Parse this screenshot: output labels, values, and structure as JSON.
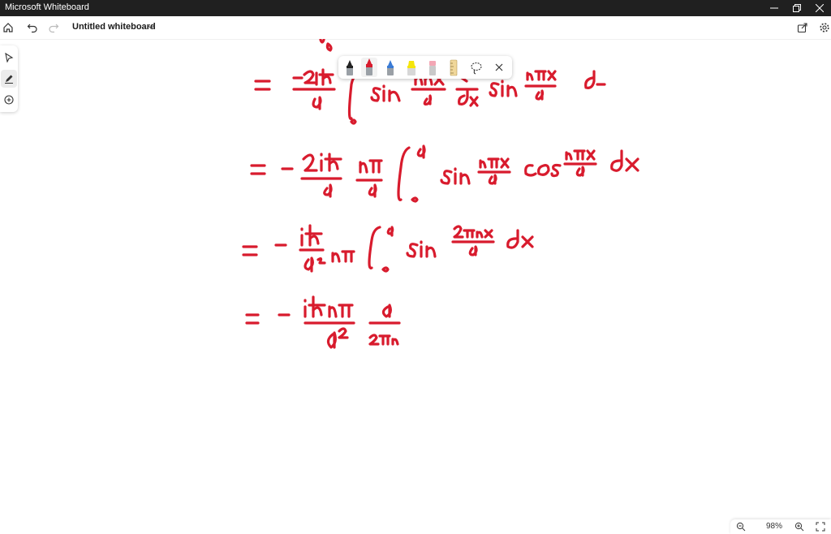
{
  "app": {
    "title": "Microsoft Whiteboard"
  },
  "toolbar": {
    "board_title": "Untitled whiteboard"
  },
  "icons": {
    "home": "home-icon",
    "undo": "undo-icon",
    "redo": "redo-icon",
    "share": "share-icon",
    "settings": "gear-icon",
    "select": "select-arrow-icon",
    "inking": "pen-icon",
    "add": "plus-circle-icon"
  },
  "ink_tray": {
    "tools": [
      "black-pen",
      "red-pen",
      "blue-pen",
      "highlighter",
      "eraser",
      "ruler",
      "lasso",
      "close"
    ],
    "selected": "red-pen"
  },
  "colors": {
    "ink": "#d81b2d",
    "titlebar": "#202020",
    "accent": "#5b5fc7"
  },
  "canvas": {
    "content": "handwritten mathematical derivation in red ink (integral of sin terms)"
  },
  "status": {
    "zoom": "98%"
  }
}
